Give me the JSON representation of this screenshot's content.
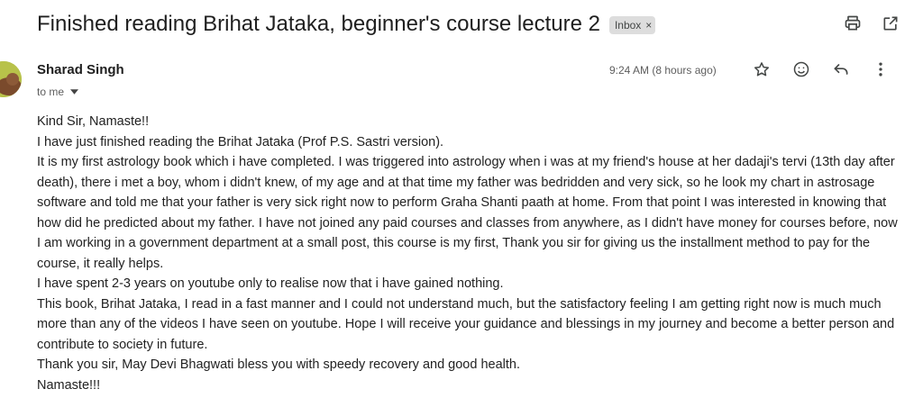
{
  "email": {
    "subject": "Finished reading Brihat Jataka, beginner's course lecture 2",
    "label": "Inbox",
    "label_remove_glyph": "×",
    "sender": "Sharad Singh",
    "recipient_line": "to me",
    "timestamp": "9:24 AM (8 hours ago)",
    "body_lines": [
      "Kind Sir, Namaste!!",
      "I have just finished reading the Brihat Jataka (Prof  P.S. Sastri version).",
      "It is my first astrology book which i have completed. I was triggered into astrology when i was at my friend's house at her dadaji's tervi (13th day after death), there i met a boy, whom i didn't knew, of my age and at that time my father was bedridden and very sick, so he look my chart in astrosage software and told me that your father is very sick right now to perform Graha Shanti paath at home. From that point I was interested in knowing that how did he predicted about my father. I have not joined any paid courses and classes from anywhere, as  I didn't have money for courses before, now I am working in a government department at a small post,  this course is my first, Thank you sir for giving us the installment method to pay for the course, it really helps.",
      "I have spent 2-3 years on youtube only to realise now that i have gained nothing.",
      "This book, Brihat Jataka, I read in a fast manner and I could not understand much, but the satisfactory feeling I am getting right now is much much more than any of the videos I have seen on youtube. Hope I will receive your guidance and blessings in my journey and become a better person and contribute to society in future.",
      "Thank you sir, May Devi Bhagwati bless you with speedy recovery and good health.",
      "Namaste!!!"
    ]
  },
  "icons": {
    "print": "print-icon",
    "open_new_window": "open-in-new-window-icon",
    "star": "star-icon",
    "emoji": "emoji-reaction-icon",
    "reply": "reply-icon",
    "more": "more-vertical-icon",
    "dropdown": "chevron-down-icon"
  },
  "colors": {
    "subject_text": "#1f1f1f",
    "label_bg": "#dddddd",
    "muted_text": "#5e5e5e",
    "body_text": "#222222",
    "icon": "#444746"
  }
}
